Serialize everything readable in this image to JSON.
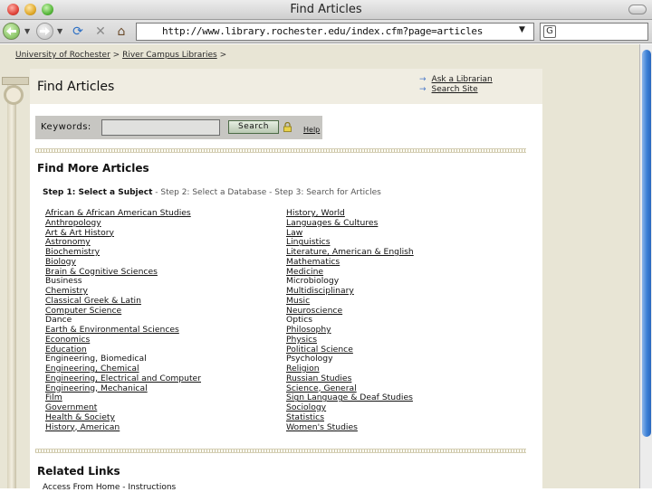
{
  "window": {
    "title": "Find Articles"
  },
  "browser": {
    "url": "http://www.library.rochester.edu/index.cfm?page=articles"
  },
  "breadcrumb": {
    "items": [
      "University of Rochester",
      "River Campus Libraries"
    ],
    "separator": ">"
  },
  "header": {
    "title": "Find Articles",
    "links": [
      "Ask a Librarian",
      "Search Site"
    ]
  },
  "search": {
    "label": "Keywords:",
    "value": "",
    "button": "Search",
    "help": "Help"
  },
  "find_more": {
    "heading": "Find More Articles",
    "step1": "Step 1: Select a Subject",
    "rest": "- Step 2: Select a Database - Step 3: Search for Articles"
  },
  "subjects_left": [
    {
      "name": "African & African American Studies",
      "link": true
    },
    {
      "name": "Anthropology",
      "link": true
    },
    {
      "name": "Art & Art History",
      "link": true
    },
    {
      "name": "Astronomy",
      "link": true
    },
    {
      "name": "Biochemistry",
      "link": true
    },
    {
      "name": "Biology",
      "link": true
    },
    {
      "name": "Brain & Cognitive Sciences",
      "link": true
    },
    {
      "name": "Business",
      "link": false
    },
    {
      "name": "Chemistry",
      "link": true
    },
    {
      "name": "Classical Greek & Latin",
      "link": true
    },
    {
      "name": "Computer Science",
      "link": true
    },
    {
      "name": "Dance",
      "link": false
    },
    {
      "name": "Earth & Environmental Sciences",
      "link": true
    },
    {
      "name": "Economics",
      "link": true
    },
    {
      "name": "Education",
      "link": true
    },
    {
      "name": "Engineering, Biomedical",
      "link": false
    },
    {
      "name": "Engineering, Chemical",
      "link": true
    },
    {
      "name": "Engineering, Electrical and Computer",
      "link": true
    },
    {
      "name": "Engineering, Mechanical",
      "link": true
    },
    {
      "name": "Film",
      "link": true
    },
    {
      "name": "Government",
      "link": true
    },
    {
      "name": "Health & Society",
      "link": true
    },
    {
      "name": "History, American",
      "link": true
    }
  ],
  "subjects_right": [
    {
      "name": "History, World",
      "link": true
    },
    {
      "name": "Languages & Cultures",
      "link": true
    },
    {
      "name": "Law",
      "link": true
    },
    {
      "name": "Linguistics",
      "link": true
    },
    {
      "name": "Literature, American & English",
      "link": true
    },
    {
      "name": "Mathematics",
      "link": true
    },
    {
      "name": "Medicine",
      "link": true
    },
    {
      "name": "Microbiology",
      "link": false
    },
    {
      "name": "Multidisciplinary",
      "link": true
    },
    {
      "name": "Music",
      "link": true
    },
    {
      "name": "Neuroscience",
      "link": true
    },
    {
      "name": "Optics",
      "link": false
    },
    {
      "name": "Philosophy",
      "link": true
    },
    {
      "name": "Physics",
      "link": true
    },
    {
      "name": "Political Science",
      "link": true
    },
    {
      "name": "Psychology",
      "link": false
    },
    {
      "name": "Religion",
      "link": true
    },
    {
      "name": "Russian Studies",
      "link": true
    },
    {
      "name": "Science, General",
      "link": true
    },
    {
      "name": "Sign Language & Deaf Studies",
      "link": true
    },
    {
      "name": "Sociology",
      "link": true
    },
    {
      "name": "Statistics",
      "link": true
    },
    {
      "name": "Women's Studies",
      "link": true
    }
  ],
  "related": {
    "heading": "Related Links",
    "access": "Access From Home - Instructions"
  }
}
